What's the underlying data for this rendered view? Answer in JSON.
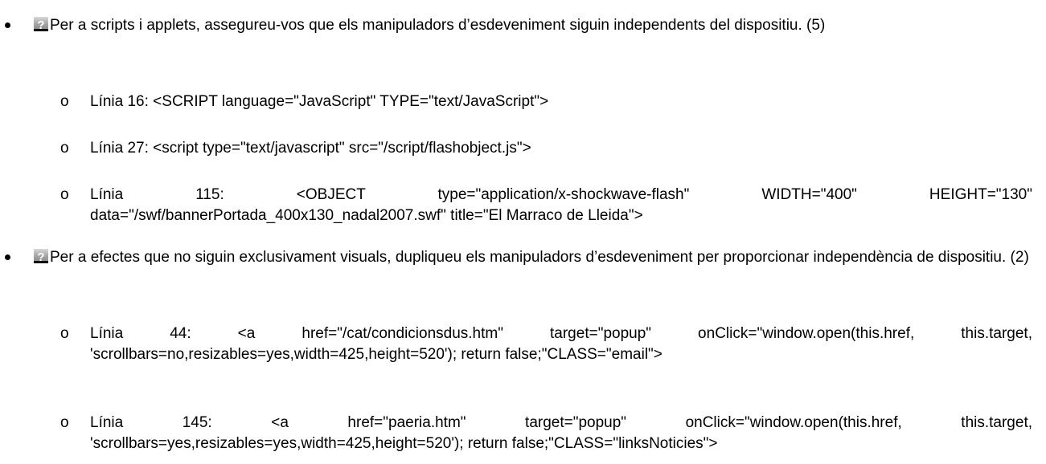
{
  "sections": [
    {
      "marker_icon": "help-icon",
      "text": "Per a scripts i applets, assegureu-vos que els manipuladors d’esdeveniment siguin independents del dispositiu. (5)",
      "items": [
        {
          "marker": "o",
          "text": "Línia 16: <SCRIPT language=\"JavaScript\" TYPE=\"text/JavaScript\">"
        },
        {
          "marker": "o",
          "text": "Línia 27: <script type=\"text/javascript\" src=\"/script/flashobject.js\">"
        },
        {
          "marker": "o",
          "text": "Línia 115: <OBJECT type=\"application/x-shockwave-flash\" WIDTH=\"400\" HEIGHT=\"130\" data=\"/swf/bannerPortada_400x130_nadal2007.swf\" title=\"El Marraco de Lleida\">"
        }
      ]
    },
    {
      "marker_icon": "help-icon",
      "text": "Per a efectes que no siguin exclusivament visuals, dupliqueu els manipuladors d’esdeveniment per proporcionar independència de dispositiu. (2)",
      "items": [
        {
          "marker": "o",
          "text": "Línia 44: <a href=\"/cat/condicionsdus.htm\" target=\"popup\" onClick=\"window.open(this.href, this.target, 'scrollbars=no,resizables=yes,width=425,height=520'); return false;\"CLASS=\"email\">"
        },
        {
          "marker": "o",
          "text": "Línia 145: <a href=\"paeria.htm\" target=\"popup\" onClick=\"window.open(this.href, this.target, 'scrollbars=yes,resizables=yes,width=425,height=520'); return false;\"CLASS=\"linksNoticies\">"
        }
      ]
    }
  ],
  "icon_glyph": "?"
}
